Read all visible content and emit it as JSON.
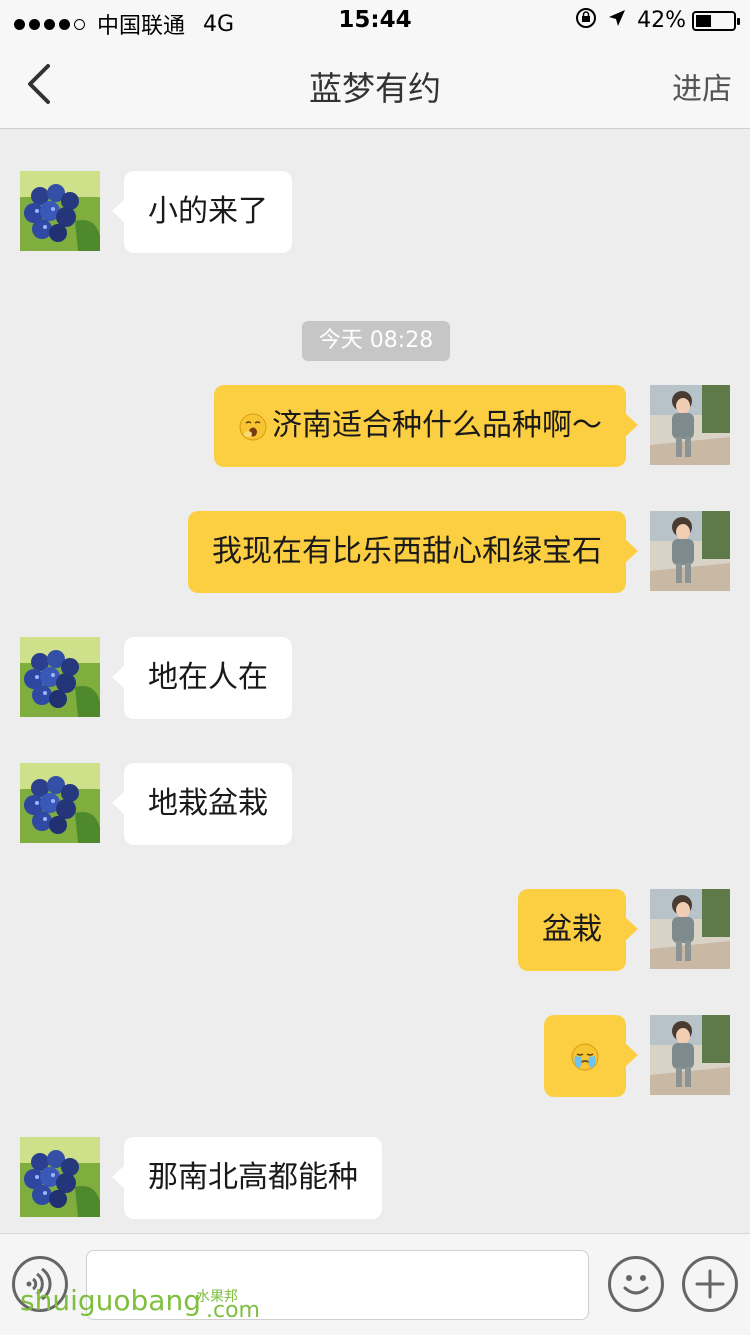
{
  "status_bar": {
    "carrier": "中国联通",
    "network": "4G",
    "time": "15:44",
    "battery": "42%",
    "battery_level": 0.42,
    "signal_bars": 4
  },
  "nav": {
    "title": "蓝梦有约",
    "right_action": "进店"
  },
  "messages": [
    {
      "side": "left",
      "text": "小的来了",
      "avatar": "blueberry-avatar"
    },
    {
      "type": "timestamp",
      "text": "今天 08:28"
    },
    {
      "side": "right",
      "text": "济南适合种什么品种啊～",
      "emoji_prefix": "yawn-emoji",
      "avatar": "boy-avatar"
    },
    {
      "side": "right",
      "text": "我现在有比乐西甜心和绿宝石",
      "avatar": "boy-avatar"
    },
    {
      "side": "left",
      "text": "地在人在",
      "avatar": "blueberry-avatar"
    },
    {
      "side": "left",
      "text": "地栽盆栽",
      "avatar": "blueberry-avatar"
    },
    {
      "side": "right",
      "text": "盆栽",
      "avatar": "boy-avatar"
    },
    {
      "side": "right",
      "text": "",
      "emoji_only": "crying-emoji",
      "avatar": "boy-avatar"
    },
    {
      "side": "left",
      "text": "那南北高都能种",
      "avatar": "blueberry-avatar"
    }
  ],
  "input_bar": {
    "voice_icon": "voice-icon",
    "emoji_icon": "smiley-icon",
    "plus_icon": "plus-icon"
  },
  "watermark": {
    "text": "shuiguobang",
    "cn": "水果邦",
    "suffix": ".com"
  },
  "colors": {
    "self_bubble": "#fccf43",
    "other_bubble": "#ffffff",
    "background": "#ededed"
  }
}
